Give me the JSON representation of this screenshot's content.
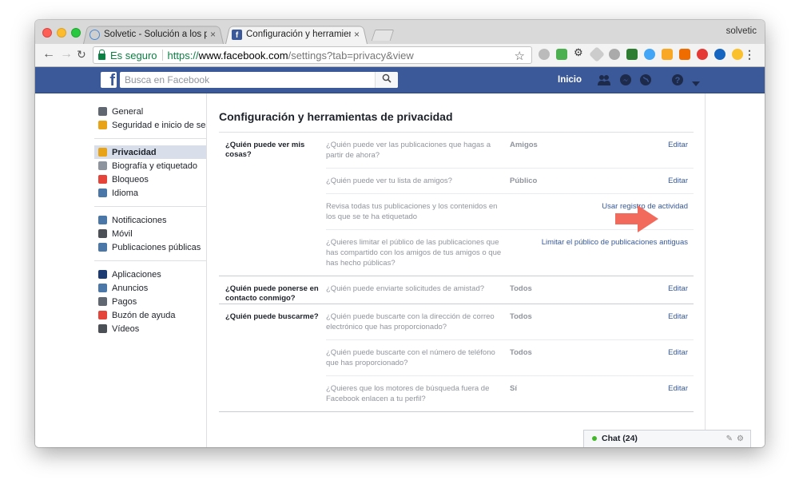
{
  "browser": {
    "profile_name": "solvetic",
    "tabs": [
      {
        "title": "Solvetic - Solución a los problemas",
        "close": "×"
      },
      {
        "title": "Configuración y herramientas de privacidad",
        "close": "×"
      }
    ],
    "security_label": "Es seguro",
    "url_scheme": "https://",
    "url_host": "www.facebook.com",
    "url_path": "/settings?tab=privacy&view"
  },
  "fb_header": {
    "logo": "f",
    "search_placeholder": "Busca en Facebook",
    "home_label": "Inicio"
  },
  "sidebar": {
    "groups": [
      [
        {
          "label": "General",
          "icon": "gears-icon",
          "color": "#606770"
        },
        {
          "label": "Seguridad e inicio de sesión",
          "icon": "shield-icon",
          "color": "#e8a317"
        }
      ],
      [
        {
          "label": "Privacidad",
          "icon": "lock-icon",
          "color": "#e8a317",
          "selected": true
        },
        {
          "label": "Biografía y etiquetado",
          "icon": "timeline-icon",
          "color": "#8d949e"
        },
        {
          "label": "Bloqueos",
          "icon": "block-icon",
          "color": "#e4443a"
        },
        {
          "label": "Idioma",
          "icon": "language-icon",
          "color": "#4a76a8"
        }
      ],
      [
        {
          "label": "Notificaciones",
          "icon": "globe-icon",
          "color": "#4a76a8"
        },
        {
          "label": "Móvil",
          "icon": "mobile-icon",
          "color": "#4b4f56"
        },
        {
          "label": "Publicaciones públicas",
          "icon": "rss-icon",
          "color": "#4a76a8"
        }
      ],
      [
        {
          "label": "Aplicaciones",
          "icon": "apps-icon",
          "color": "#1d3b73"
        },
        {
          "label": "Anuncios",
          "icon": "ads-icon",
          "color": "#4a76a8"
        },
        {
          "label": "Pagos",
          "icon": "card-icon",
          "color": "#606770"
        },
        {
          "label": "Buzón de ayuda",
          "icon": "lifebuoy-icon",
          "color": "#e4443a"
        },
        {
          "label": "Vídeos",
          "icon": "film-icon",
          "color": "#4b4f56"
        }
      ]
    ]
  },
  "main": {
    "title": "Configuración y herramientas de privacidad",
    "sections": [
      {
        "label": "¿Quién puede ver mis cosas?",
        "rows": [
          {
            "question": "¿Quién puede ver las publicaciones que hagas a partir de ahora?",
            "value": "Amigos",
            "action": "Editar"
          },
          {
            "question": "¿Quién puede ver tu lista de amigos?",
            "value": "Público",
            "action": "Editar"
          },
          {
            "question": "Revisa todas tus publicaciones y los contenidos en los que se te ha etiquetado",
            "value": "",
            "action": "Usar registro de actividad"
          },
          {
            "question": "¿Quieres limitar el público de las publicaciones que has compartido con los amigos de tus amigos o que has hecho públicas?",
            "value": "",
            "action": "Limitar el público de publicaciones antiguas"
          }
        ]
      },
      {
        "label": "¿Quién puede ponerse en contacto conmigo?",
        "rows": [
          {
            "question": "¿Quién puede enviarte solicitudes de amistad?",
            "value": "Todos",
            "action": "Editar"
          }
        ]
      },
      {
        "label": "¿Quién puede buscarme?",
        "rows": [
          {
            "question": "¿Quién puede buscarte con la dirección de correo electrónico que has proporcionado?",
            "value": "Todos",
            "action": "Editar"
          },
          {
            "question": "¿Quién puede buscarte con el número de teléfono que has proporcionado?",
            "value": "Todos",
            "action": "Editar"
          },
          {
            "question": "¿Quieres que los motores de búsqueda fuera de Facebook enlacen a tu perfil?",
            "value": "Sí",
            "action": "Editar"
          }
        ]
      }
    ]
  },
  "chat": {
    "label": "Chat (24)"
  }
}
